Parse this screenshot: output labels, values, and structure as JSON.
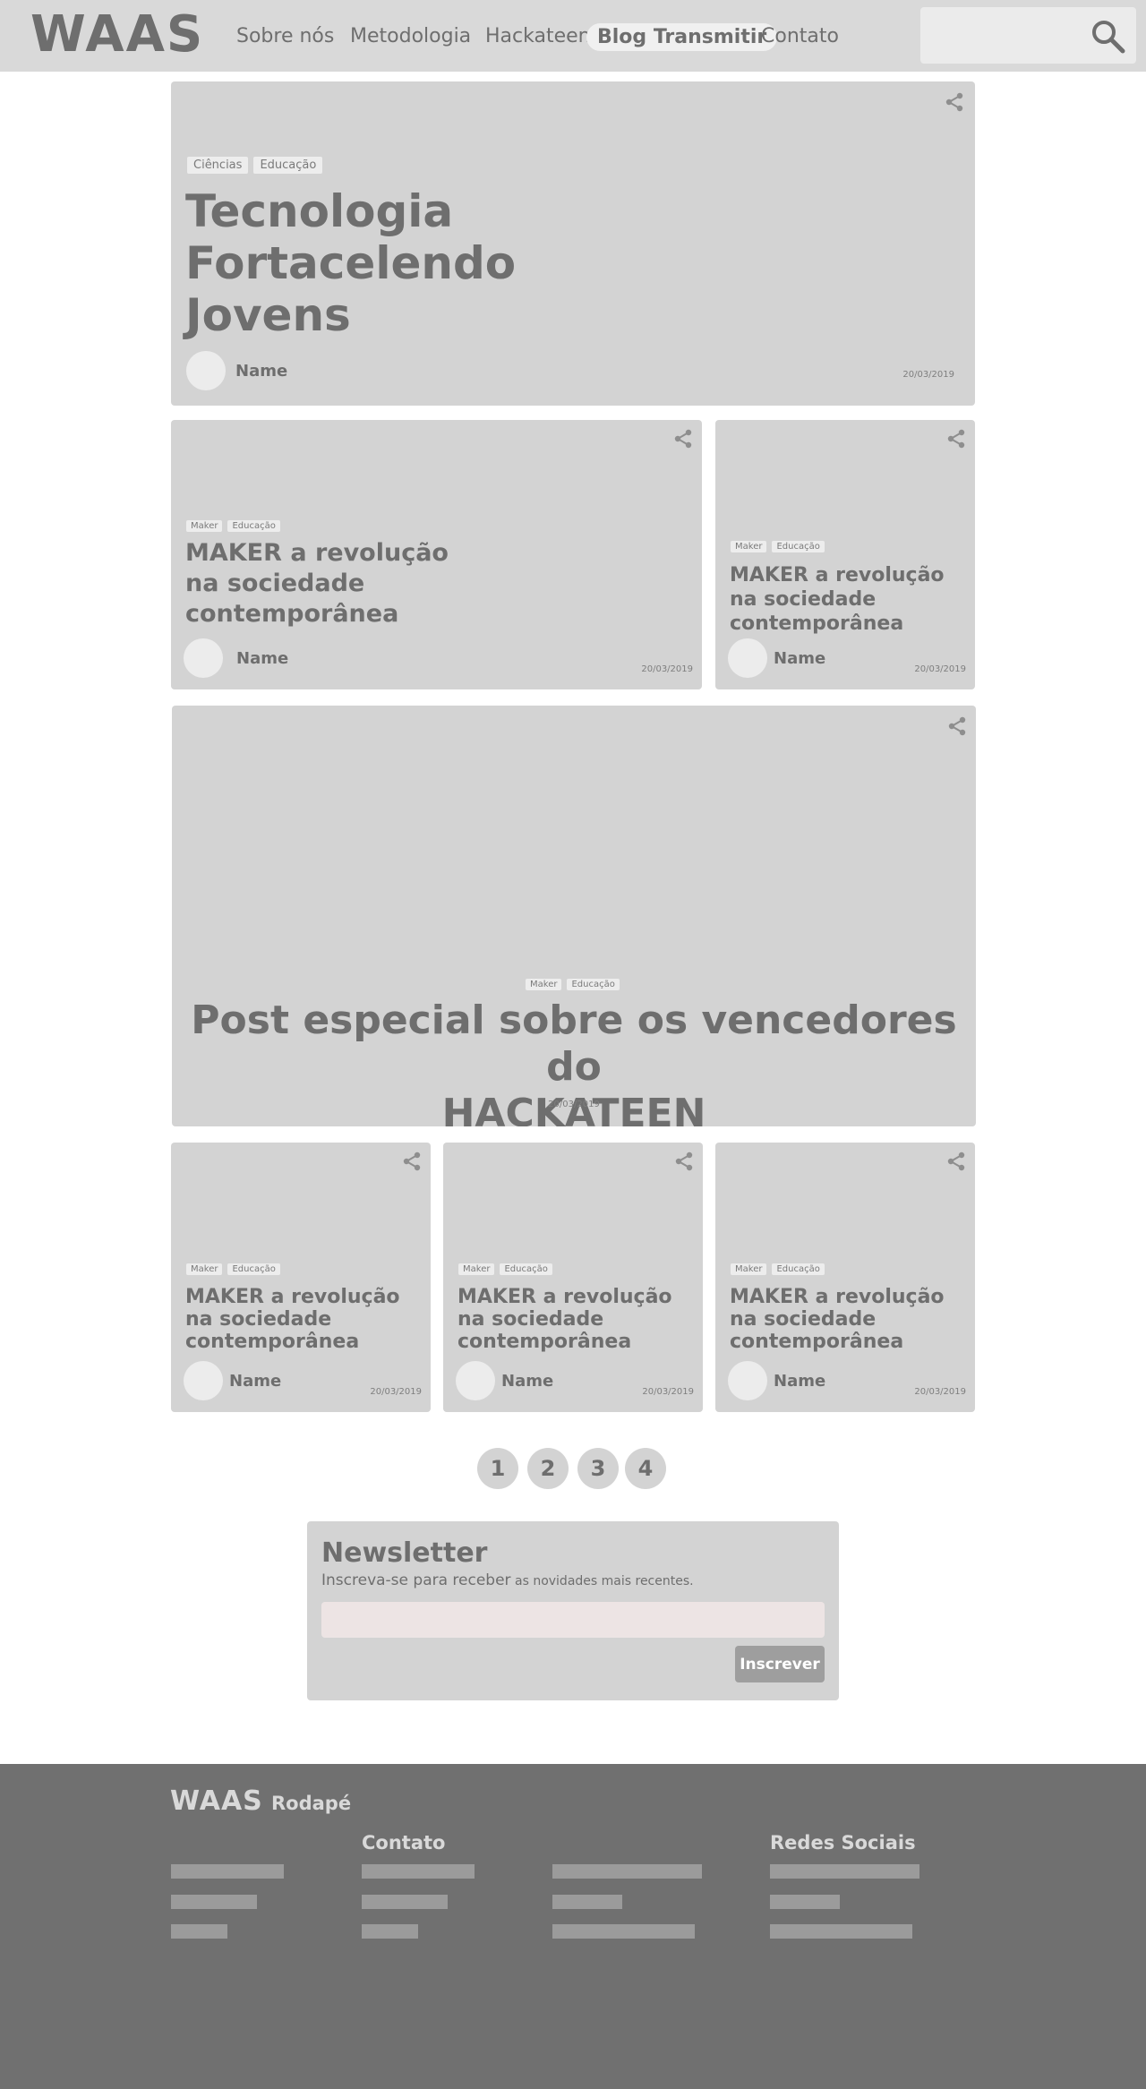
{
  "header": {
    "logo": "WAAS",
    "nav": [
      "Sobre nós",
      "Metodologia",
      "Hackateen",
      "Blog Transmitir",
      "Contato"
    ],
    "active_nav": "Blog Transmitir",
    "search_icon": "search-icon"
  },
  "featured": {
    "tags": [
      "Ciências",
      "Educação"
    ],
    "title_lines": [
      "Tecnologia",
      "Fortacelendo",
      "Jovens"
    ],
    "author": "Name",
    "date": "20/03/2019"
  },
  "row2": [
    {
      "tags": [
        "Maker",
        "Educação"
      ],
      "title_lines": [
        "MAKER a revolução",
        "na sociedade",
        "contemporânea"
      ],
      "author": "Name",
      "date": "20/03/2019"
    },
    {
      "tags": [
        "Maker",
        "Educação"
      ],
      "title_lines": [
        "MAKER a revolução",
        "na sociedade",
        "contemporânea"
      ],
      "author": "Name",
      "date": "20/03/2019"
    }
  ],
  "special": {
    "tags": [
      "Maker",
      "Educação"
    ],
    "title_lines": [
      "Post especial sobre os vencedores do",
      "HACKATEEN"
    ],
    "date": "20/03/2019"
  },
  "row4": [
    {
      "tags": [
        "Maker",
        "Educação"
      ],
      "title_lines": [
        "MAKER a revolução",
        "na sociedade",
        "contemporânea"
      ],
      "author": "Name",
      "date": "20/03/2019"
    },
    {
      "tags": [
        "Maker",
        "Educação"
      ],
      "title_lines": [
        "MAKER a revolução",
        "na sociedade",
        "contemporânea"
      ],
      "author": "Name",
      "date": "20/03/2019"
    },
    {
      "tags": [
        "Maker",
        "Educação"
      ],
      "title_lines": [
        "MAKER a revolução",
        "na sociedade",
        "contemporânea"
      ],
      "author": "Name",
      "date": "20/03/2019"
    }
  ],
  "pagination": [
    "1",
    "2",
    "3",
    "4"
  ],
  "newsletter": {
    "title": "Newsletter",
    "subtitle_main": "Inscreva-se para receber",
    "subtitle_small": " as novidades mais recentes.",
    "input_value": "",
    "button": "Inscrever"
  },
  "footer": {
    "logo": "WAAS",
    "label": "Rodapé",
    "col_contato": "Contato",
    "col_redes": "Redes Sociais"
  },
  "colors": {
    "header_bg": "#d9d9d9",
    "card_bg": "#d3d3d3",
    "text": "#6e6e6e",
    "footer_bg": "#707070",
    "button_bg": "#9e9e9e"
  }
}
